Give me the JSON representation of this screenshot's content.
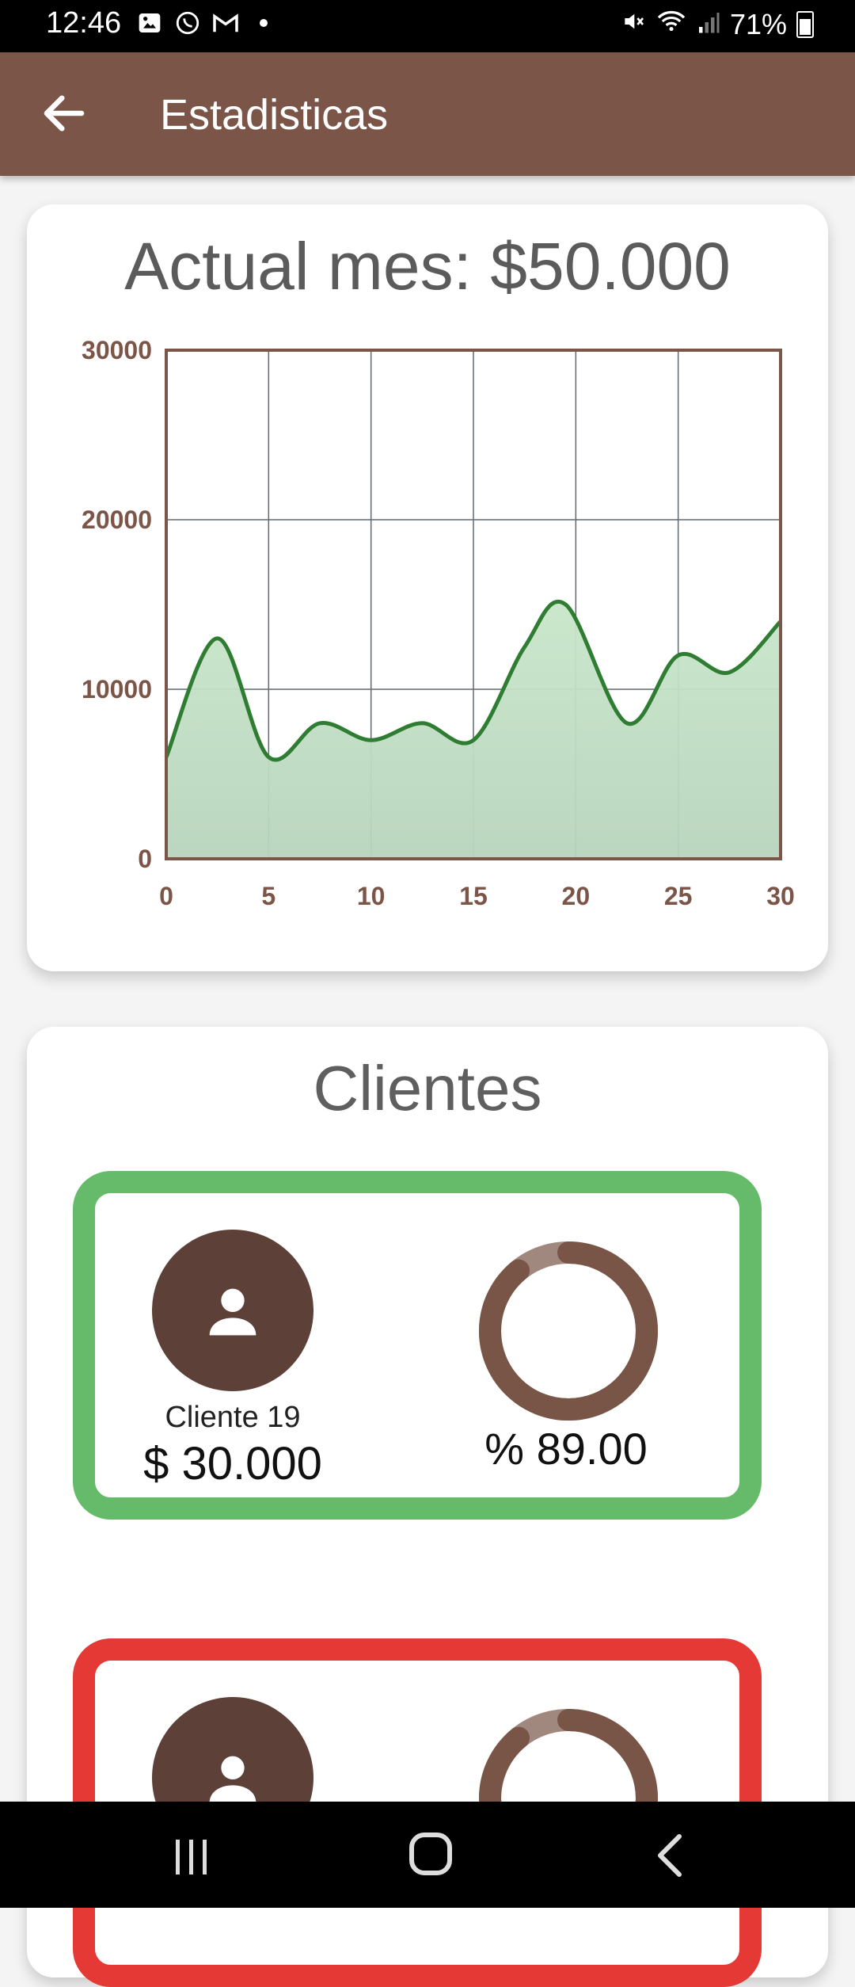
{
  "status": {
    "time": "12:46",
    "battery": "71%",
    "left_icons": [
      "image-icon",
      "whatsapp-icon",
      "gmail-icon",
      "dot-icon"
    ]
  },
  "app_bar": {
    "title": "Estadisticas"
  },
  "stats_card": {
    "title": "Actual mes: $50.000"
  },
  "chart_data": {
    "type": "area",
    "x": [
      0,
      2.5,
      5,
      7.5,
      10,
      12.5,
      15,
      17.5,
      19.5,
      22.5,
      25,
      27.5,
      30
    ],
    "y": [
      6000,
      13000,
      6000,
      8000,
      7000,
      8000,
      7000,
      12500,
      15000,
      8000,
      12000,
      11000,
      14000
    ],
    "xlim": [
      0,
      30
    ],
    "ylim": [
      0,
      30000
    ],
    "x_ticks": [
      "0",
      "5",
      "10",
      "15",
      "20",
      "25",
      "30"
    ],
    "y_ticks": [
      "0",
      "10000",
      "20000",
      "30000"
    ],
    "grid": true,
    "line_color": "#2e7d32",
    "fill_color": "#a5d6a7",
    "axis_color": "#7b5548"
  },
  "clients_section": {
    "title": "Clientes",
    "items": [
      {
        "name": "Cliente 19",
        "amount": "$ 30.000",
        "percent": "% 89.00",
        "progress": 0.89,
        "border_color": "#66bb6a"
      },
      {
        "name": "",
        "amount": "",
        "percent": "",
        "progress": 0.89,
        "border_color": "#e53935"
      }
    ]
  }
}
